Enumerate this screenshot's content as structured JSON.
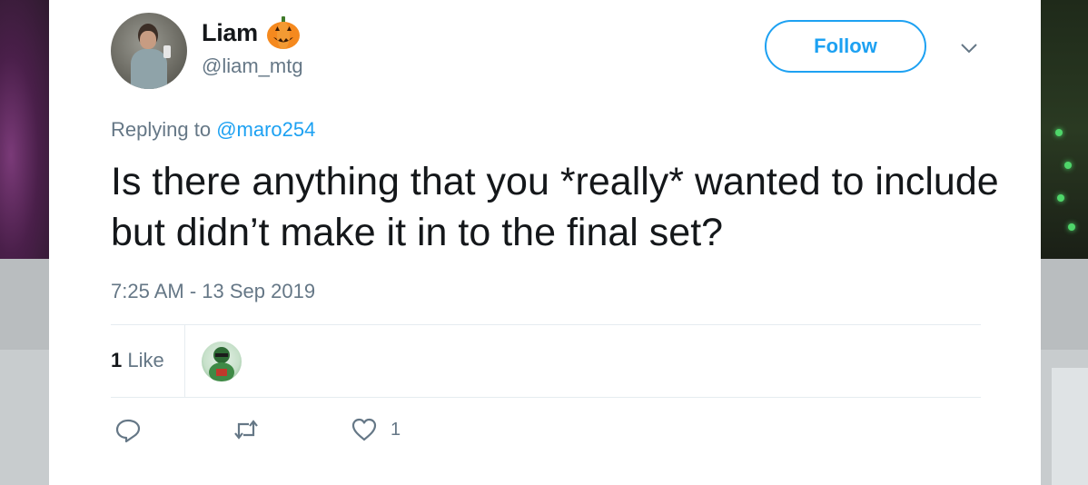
{
  "user": {
    "name": "Liam",
    "emoji": "pumpkin",
    "handle": "@liam_mtg"
  },
  "follow_label": "Follow",
  "reply_context": {
    "prefix": "Replying to ",
    "mention": "@maro254"
  },
  "tweet_text": "Is there anything that you *really* wanted to include but didn’t make it in to the final set?",
  "timestamp": "7:25 AM - 13 Sep 2019",
  "likes": {
    "count": "1",
    "label": " Like"
  },
  "actions": {
    "like_count": "1"
  },
  "colors": {
    "accent": "#1da1f2",
    "secondary_text": "#657786",
    "primary_text": "#14171a",
    "divider": "#e6ecf0"
  }
}
